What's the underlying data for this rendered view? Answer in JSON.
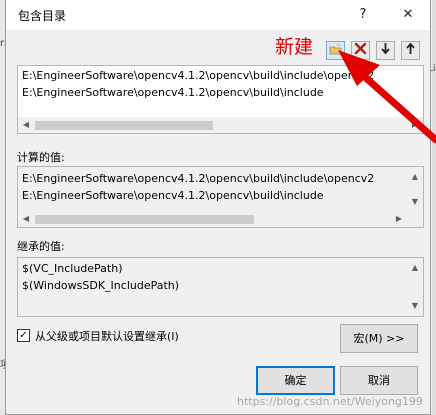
{
  "dialog": {
    "title": "包含目录",
    "help_label": "?",
    "close_label": "✕"
  },
  "background_text": {
    "left_top": "rs",
    "right_top": "Li",
    "left_bottom": "项"
  },
  "toolbar": {
    "new_line_icon": "new-folder-icon",
    "delete_icon": "delete-icon",
    "move_down_icon": "arrow-down-icon",
    "move_up_icon": "arrow-up-icon",
    "annotation_label": "新建",
    "annotation_color": "#e30000"
  },
  "edit_list": {
    "lines": [
      "E:\\EngineerSoftware\\opencv4.1.2\\opencv\\build\\include\\opencv2",
      "E:\\EngineerSoftware\\opencv4.1.2\\opencv\\build\\include"
    ]
  },
  "evaluated": {
    "label": "计算的值:",
    "lines": [
      "E:\\EngineerSoftware\\opencv4.1.2\\opencv\\build\\include\\opencv2",
      "E:\\EngineerSoftware\\opencv4.1.2\\opencv\\build\\include"
    ]
  },
  "inherited": {
    "label": "继承的值:",
    "lines": [
      "$(VC_IncludePath)",
      "$(WindowsSDK_IncludePath)"
    ]
  },
  "inherit_checkbox": {
    "label": "从父级或项目默认设置继承(I)",
    "checked": true
  },
  "buttons": {
    "macros": "宏(M) >>",
    "ok": "确定",
    "cancel": "取消"
  },
  "watermark": "https://blog.csdn.net/Weiyong199"
}
